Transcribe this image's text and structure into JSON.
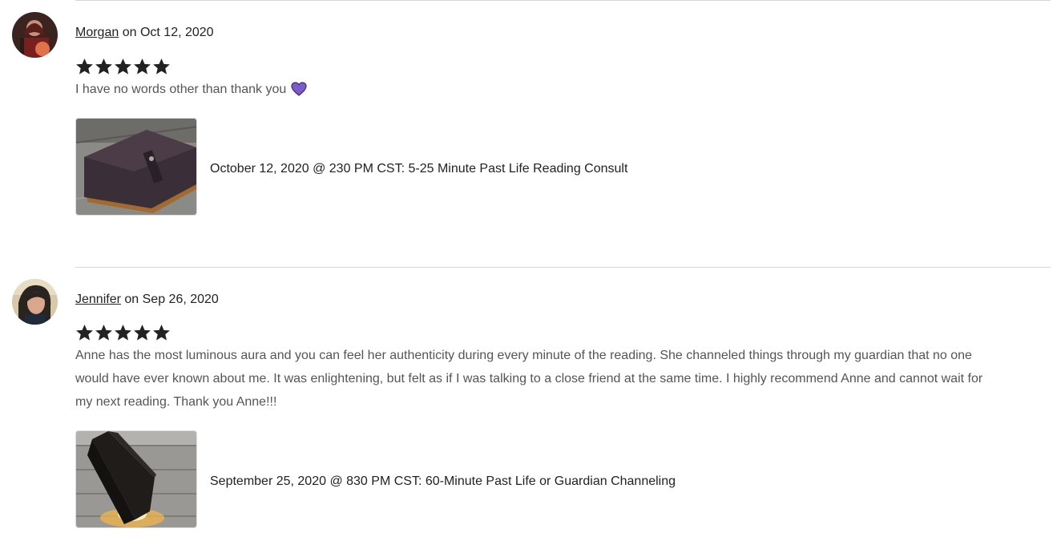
{
  "reviews": [
    {
      "author": "Morgan",
      "date_prefix": "on",
      "date": "Oct 12, 2020",
      "rating": 5,
      "text": "I have no words other than thank you",
      "emoji": "purple-heart",
      "product_title": "October 12, 2020 @ 230 PM CST: 5-25 Minute Past Life Reading Consult",
      "product_image": "leather-journal"
    },
    {
      "author": "Jennifer",
      "date_prefix": "on",
      "date": "Sep 26, 2020",
      "rating": 5,
      "text": "Anne has the most luminous aura and you can feel her authenticity during every minute of the reading. She channeled things through my guardian that no one would have ever known about me. It was enlightening, but felt as if I was talking to a close friend at the same time. I highly recommend Anne and cannot wait for my next reading. Thank you Anne!!!",
      "product_title": "September 25, 2020 @ 830 PM CST: 60-Minute Past Life or Guardian Channeling",
      "product_image": "glowing-open-book"
    }
  ],
  "colors": {
    "star": "#222222",
    "heart": "#7b5cc9",
    "divider": "#d6d6d6",
    "review_text": "#555555"
  }
}
